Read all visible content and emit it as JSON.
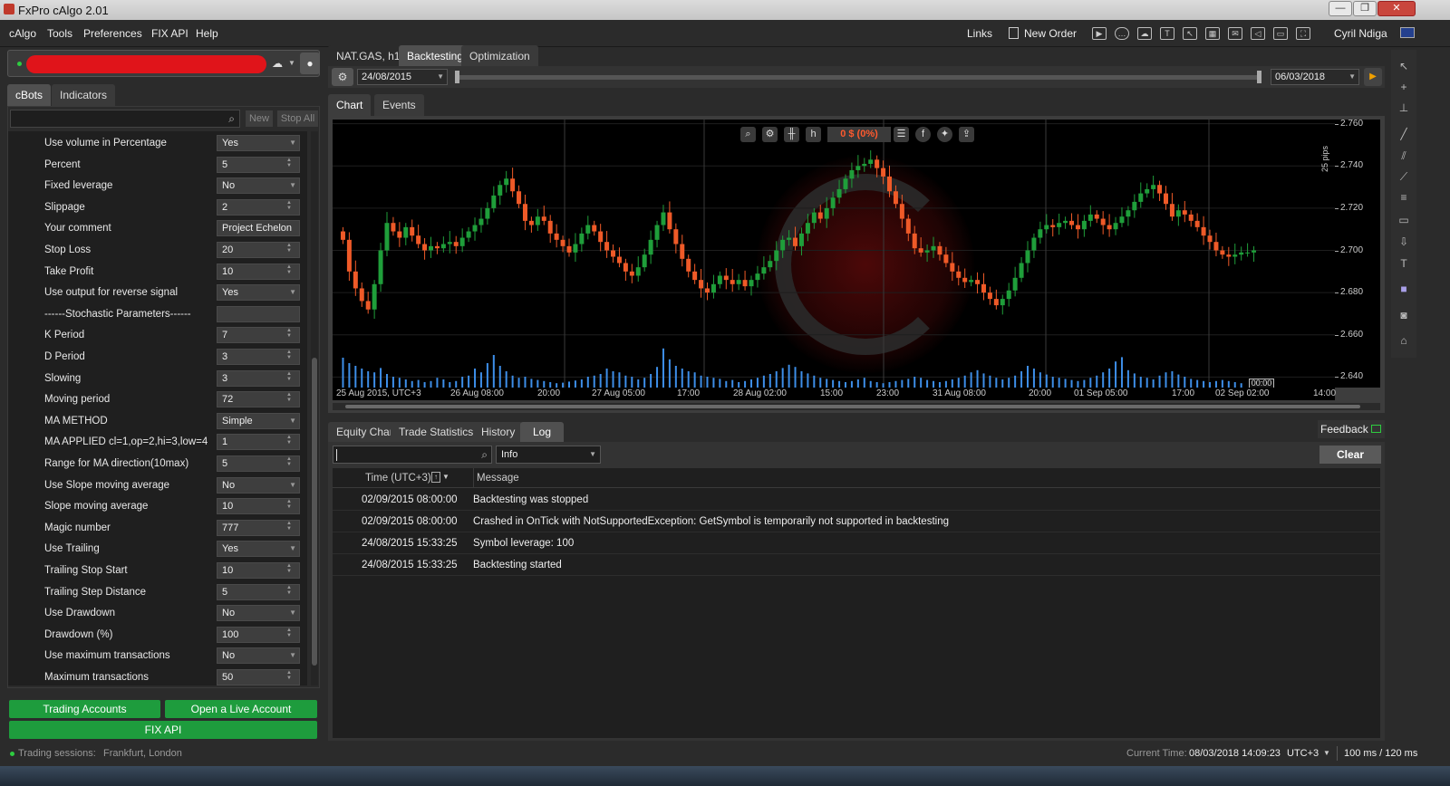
{
  "window": {
    "title": "FxPro cAlgo 2.01",
    "minimize": "—",
    "maximize": "❐",
    "close": "✕"
  },
  "menu": {
    "items": [
      "cAlgo",
      "Tools",
      "Preferences",
      "FIX API",
      "Help"
    ]
  },
  "toolbar": {
    "links": "Links",
    "new_order": "New Order",
    "user": "Cyril Ndiga"
  },
  "left_panel": {
    "tabs": [
      "cBots",
      "Indicators"
    ],
    "search_placeholder": "",
    "new_label": "New",
    "stop_all_label": "Stop All",
    "params": [
      {
        "label": "Use volume in Percentage",
        "value": "Yes",
        "kind": "select"
      },
      {
        "label": "Percent",
        "value": "5",
        "kind": "number"
      },
      {
        "label": "Fixed leverage",
        "value": "No",
        "kind": "select"
      },
      {
        "label": "Slippage",
        "value": "2",
        "kind": "number"
      },
      {
        "label": "Your comment",
        "value": "Project Echelon",
        "kind": "text"
      },
      {
        "label": "Stop Loss",
        "value": "20",
        "kind": "number"
      },
      {
        "label": "Take Profit",
        "value": "10",
        "kind": "number"
      },
      {
        "label": "Use output for reverse signal",
        "value": "Yes",
        "kind": "select"
      },
      {
        "label": "------Stochastic Parameters------",
        "value": "",
        "kind": "text"
      },
      {
        "label": "K Period",
        "value": "7",
        "kind": "number"
      },
      {
        "label": "D Period",
        "value": "3",
        "kind": "number"
      },
      {
        "label": "Slowing",
        "value": "3",
        "kind": "number"
      },
      {
        "label": "Moving period",
        "value": "72",
        "kind": "number"
      },
      {
        "label": "MA METHOD",
        "value": "Simple",
        "kind": "select"
      },
      {
        "label": "MA APPLIED cl=1,op=2,hi=3,low=4",
        "value": "1",
        "kind": "number"
      },
      {
        "label": "Range for MA direction(10max)",
        "value": "5",
        "kind": "number"
      },
      {
        "label": "Use Slope moving average",
        "value": "No",
        "kind": "select"
      },
      {
        "label": "Slope moving average",
        "value": "10",
        "kind": "number"
      },
      {
        "label": "Magic number",
        "value": "777",
        "kind": "number"
      },
      {
        "label": "Use Trailing",
        "value": "Yes",
        "kind": "select"
      },
      {
        "label": "Trailing Stop Start",
        "value": "10",
        "kind": "number"
      },
      {
        "label": "Trailing Step Distance",
        "value": "5",
        "kind": "number"
      },
      {
        "label": "Use Drawdown",
        "value": "No",
        "kind": "select"
      },
      {
        "label": "Drawdown (%)",
        "value": "100",
        "kind": "number"
      },
      {
        "label": "Use maximum transactions",
        "value": "No",
        "kind": "select"
      },
      {
        "label": "Maximum transactions",
        "value": "50",
        "kind": "number"
      }
    ],
    "trading_accounts": "Trading Accounts",
    "open_live": "Open a Live Account",
    "fix_api": "FIX API"
  },
  "main": {
    "tabs": [
      "NAT.GAS, h1",
      "Backtesting",
      "Optimization"
    ],
    "start_date": "24/08/2015",
    "end_date": "06/03/2018",
    "chart_tabs": [
      "Chart",
      "Events"
    ],
    "pnl": "0 $ (0%)",
    "pips_label": "25 pips",
    "time_marker": "00:00",
    "bottom_tabs": [
      "Equity Chart",
      "Trade Statistics",
      "History",
      "Log"
    ],
    "feedback": "Feedback",
    "log_filter": "Info",
    "clear": "Clear",
    "log_headers": {
      "time": "Time (UTC+3)",
      "message": "Message"
    },
    "log_rows": [
      {
        "time": "02/09/2015 08:00:00",
        "message": "Backtesting was stopped"
      },
      {
        "time": "02/09/2015 08:00:00",
        "message": "Crashed in OnTick with NotSupportedException: GetSymbol is temporarily not supported in backtesting"
      },
      {
        "time": "24/08/2015 15:33:25",
        "message": "Symbol leverage:  100"
      },
      {
        "time": "24/08/2015 15:33:25",
        "message": "Backtesting started"
      }
    ]
  },
  "status": {
    "sessions_label": "Trading sessions:",
    "sessions": "Frankfurt, London",
    "current_time_label": "Current Time:",
    "current_time": "08/03/2018 14:09:23",
    "tz": "UTC+3",
    "latency": "100 ms / 120 ms"
  },
  "colors": {
    "up": "#1f9e3a",
    "down": "#ef5a28",
    "volume": "#3d8ee8",
    "accent_green": "#1e9c3d"
  },
  "chart_data": {
    "type": "candlestick",
    "symbol": "NAT.GAS",
    "timeframe": "h1",
    "ylim": [
      2.635,
      2.762
    ],
    "y_ticks": [
      2.76,
      2.74,
      2.72,
      2.7,
      2.68,
      2.66,
      2.64
    ],
    "x_ticks": [
      "25 Aug 2015, UTC+3",
      "26 Aug 08:00",
      "20:00",
      "27 Aug 05:00",
      "17:00",
      "28 Aug 02:00",
      "15:00",
      "23:00",
      "31 Aug 08:00",
      "20:00",
      "01 Sep 05:00",
      "17:00",
      "02 Sep 02:00",
      "14:00"
    ],
    "close": [
      2.705,
      2.69,
      2.682,
      2.676,
      2.672,
      2.684,
      2.7,
      2.713,
      2.709,
      2.706,
      2.711,
      2.707,
      2.703,
      2.7,
      2.702,
      2.701,
      2.703,
      2.704,
      2.702,
      2.706,
      2.709,
      2.712,
      2.715,
      2.72,
      2.726,
      2.731,
      2.734,
      2.728,
      2.722,
      2.714,
      2.712,
      2.716,
      2.714,
      2.708,
      2.705,
      2.702,
      2.699,
      2.703,
      2.708,
      2.712,
      2.709,
      2.704,
      2.7,
      2.697,
      2.694,
      2.69,
      2.688,
      2.692,
      2.698,
      2.705,
      2.712,
      2.718,
      2.71,
      2.703,
      2.696,
      2.69,
      2.686,
      2.682,
      2.68,
      2.684,
      2.688,
      2.686,
      2.684,
      2.686,
      2.683,
      2.686,
      2.689,
      2.692,
      2.695,
      2.7,
      2.705,
      2.706,
      2.702,
      2.708,
      2.713,
      2.718,
      2.715,
      2.72,
      2.725,
      2.729,
      2.734,
      2.738,
      2.74,
      2.741,
      2.743,
      2.739,
      2.735,
      2.728,
      2.722,
      2.715,
      2.708,
      2.701,
      2.699,
      2.7,
      2.702,
      2.698,
      2.694,
      2.69,
      2.687,
      2.685,
      2.686,
      2.684,
      2.68,
      2.677,
      2.674,
      2.677,
      2.681,
      2.687,
      2.694,
      2.7,
      2.706,
      2.71,
      2.712,
      2.711,
      2.713,
      2.714,
      2.712,
      2.71,
      2.714,
      2.717,
      2.715,
      2.712,
      2.71,
      2.713,
      2.716,
      2.719,
      2.723,
      2.727,
      2.729,
      2.731,
      2.727,
      2.722,
      2.716,
      2.719,
      2.717,
      2.714,
      2.711,
      2.707,
      2.704,
      2.7,
      2.698,
      2.697,
      2.698,
      2.699,
      2.699,
      2.7
    ],
    "volume": [
      0.55,
      0.45,
      0.4,
      0.35,
      0.3,
      0.28,
      0.36,
      0.25,
      0.2,
      0.18,
      0.15,
      0.12,
      0.14,
      0.1,
      0.12,
      0.18,
      0.15,
      0.1,
      0.12,
      0.2,
      0.22,
      0.35,
      0.28,
      0.45,
      0.6,
      0.4,
      0.3,
      0.22,
      0.18,
      0.2,
      0.16,
      0.14,
      0.12,
      0.1,
      0.08,
      0.09,
      0.11,
      0.13,
      0.15,
      0.2,
      0.22,
      0.25,
      0.35,
      0.3,
      0.28,
      0.22,
      0.2,
      0.15,
      0.18,
      0.25,
      0.38,
      0.72,
      0.52,
      0.4,
      0.35,
      0.3,
      0.28,
      0.22,
      0.2,
      0.18,
      0.16,
      0.12,
      0.14,
      0.1,
      0.12,
      0.15,
      0.18,
      0.22,
      0.25,
      0.3,
      0.36,
      0.42,
      0.38,
      0.3,
      0.26,
      0.22,
      0.18,
      0.16,
      0.14,
      0.12,
      0.1,
      0.12,
      0.15,
      0.18,
      0.12,
      0.1,
      0.08,
      0.1,
      0.12,
      0.14,
      0.16,
      0.2,
      0.18,
      0.14,
      0.12,
      0.1,
      0.12,
      0.15,
      0.18,
      0.22,
      0.28,
      0.32,
      0.26,
      0.22,
      0.18,
      0.15,
      0.18,
      0.22,
      0.3,
      0.4,
      0.35,
      0.28,
      0.24,
      0.2,
      0.18,
      0.16,
      0.14,
      0.12,
      0.14,
      0.18,
      0.22,
      0.28,
      0.35,
      0.48,
      0.56,
      0.32,
      0.26,
      0.2,
      0.18,
      0.15,
      0.22,
      0.28,
      0.3,
      0.24,
      0.2,
      0.16,
      0.14,
      0.12,
      0.1,
      0.12,
      0.14,
      0.12,
      0.1,
      0.08
    ]
  }
}
